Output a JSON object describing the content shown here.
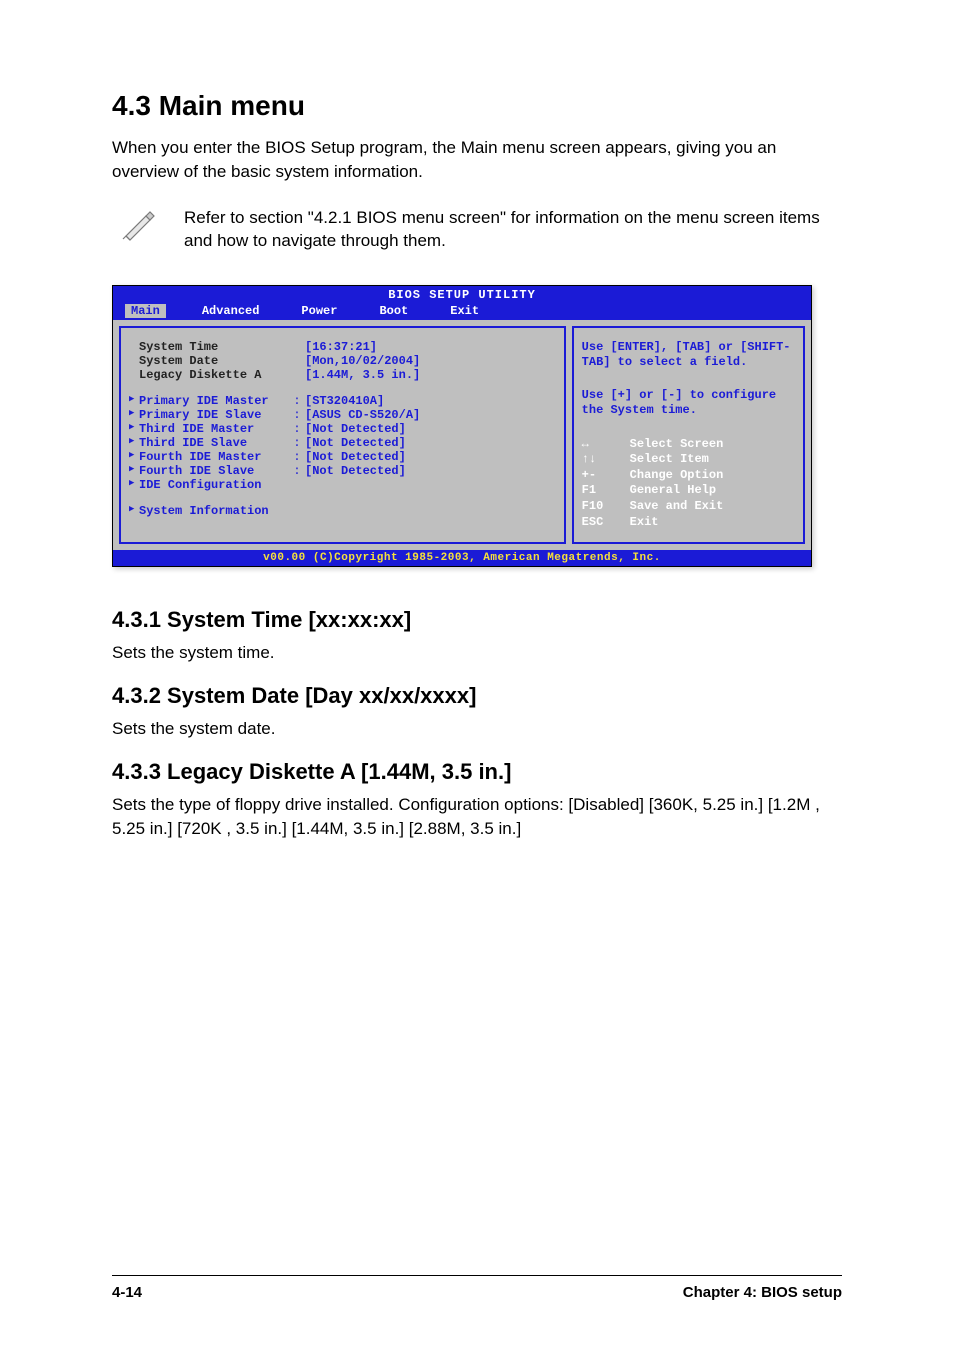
{
  "heading": "4.3    Main menu",
  "intro": "When you enter the BIOS Setup program, the Main menu screen appears, giving you an overview of the basic system information.",
  "note": "Refer to section \"4.2.1  BIOS menu screen\" for information on the menu screen items and how to navigate through them.",
  "bios": {
    "title": "BIOS SETUP UTILITY",
    "tabs": [
      "Main",
      "Advanced",
      "Power",
      "Boot",
      "Exit"
    ],
    "active_tab": "Main",
    "rows": [
      {
        "label": "System Time",
        "value": "[16:37:21]",
        "arrow": false,
        "sep": ""
      },
      {
        "label": "System Date",
        "value": "[Mon,10/02/2004]",
        "arrow": false,
        "sep": ""
      },
      {
        "label": "Legacy Diskette A",
        "value": "[1.44M, 3.5 in.]",
        "arrow": false,
        "sep": ""
      }
    ],
    "rows2": [
      {
        "label": "Primary IDE Master",
        "value": "[ST320410A]",
        "arrow": true,
        "sep": ":"
      },
      {
        "label": "Primary IDE Slave",
        "value": "[ASUS CD-S520/A]",
        "arrow": true,
        "sep": ":"
      },
      {
        "label": "Third IDE Master",
        "value": "[Not Detected]",
        "arrow": true,
        "sep": ":"
      },
      {
        "label": "Third IDE Slave",
        "value": "[Not Detected]",
        "arrow": true,
        "sep": ":"
      },
      {
        "label": "Fourth IDE Master",
        "value": "[Not Detected]",
        "arrow": true,
        "sep": ":"
      },
      {
        "label": "Fourth IDE Slave",
        "value": "[Not Detected]",
        "arrow": true,
        "sep": ":"
      },
      {
        "label": "IDE Configuration",
        "value": "",
        "arrow": true,
        "sep": ""
      }
    ],
    "rows3": [
      {
        "label": "System Information",
        "value": "",
        "arrow": true,
        "sep": ""
      }
    ],
    "help1": "Use [ENTER], [TAB] or [SHIFT-TAB] to select a field.",
    "help2": "Use [+] or [-] to configure the System time.",
    "keys": [
      {
        "key": "↔",
        "desc": "Select Screen"
      },
      {
        "key": "↑↓",
        "desc": "Select Item"
      },
      {
        "key": "+-",
        "desc": "Change Option"
      },
      {
        "key": "F1",
        "desc": "General Help"
      },
      {
        "key": "F10",
        "desc": "Save and Exit"
      },
      {
        "key": "ESC",
        "desc": "Exit"
      }
    ],
    "footer": "v00.00 (C)Copyright 1985-2003, American Megatrends, Inc."
  },
  "sub1": {
    "title": "4.3.1   System Time [xx:xx:xx]",
    "desc": "Sets the system time."
  },
  "sub2": {
    "title": "4.3.2   System Date [Day xx/xx/xxxx]",
    "desc": "Sets the system date."
  },
  "sub3": {
    "title": "4.3.3   Legacy Diskette A [1.44M, 3.5 in.]",
    "desc": "Sets the type of floppy drive installed. Configuration options: [Disabled] [360K, 5.25 in.] [1.2M , 5.25 in.] [720K , 3.5 in.] [1.44M, 3.5 in.] [2.88M, 3.5 in.]"
  },
  "footer": {
    "page": "4-14",
    "chapter": "Chapter 4: BIOS setup"
  }
}
